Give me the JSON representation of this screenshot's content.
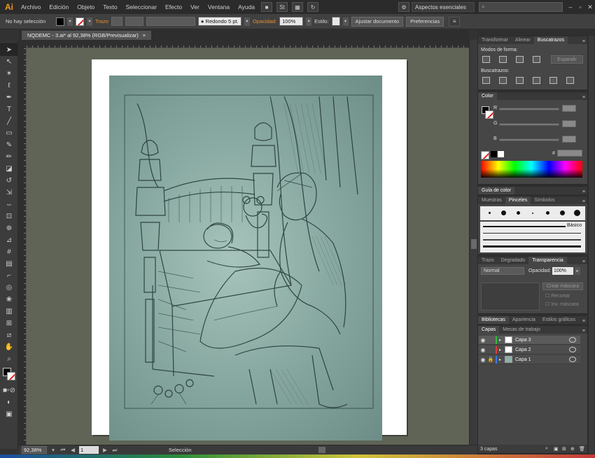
{
  "app": {
    "logo": "Ai"
  },
  "menu": [
    "Archivo",
    "Edición",
    "Objeto",
    "Texto",
    "Seleccionar",
    "Efecto",
    "Ver",
    "Ventana",
    "Ayuda"
  ],
  "menubar_right": {
    "workspace": "Aspectos esenciales",
    "search_placeholder": ""
  },
  "control": {
    "selection": "No hay selección",
    "stroke_label": "Trazo",
    "brush": "Redondo 5 pt.",
    "opacity_label": "Opacidad:",
    "opacity": "100%",
    "style_label": "Estilo:",
    "doc_setup": "Ajustar documento",
    "prefs": "Preferencias"
  },
  "document": {
    "tab_title": "NQDEMC - 3.ai* al 92,38% (RGB/Previsualizar)",
    "close": "×"
  },
  "status": {
    "zoom": "92,38%",
    "page": "1",
    "tool": "Selección"
  },
  "pathfinder": {
    "tabs": [
      "Transformar",
      "Alinear",
      "Buscatrazos"
    ],
    "shape_modes_label": "Modos de forma:",
    "expand_button": "Expandir",
    "pathfinders_label": "Buscatrazos:"
  },
  "color_panel": {
    "title": "Color",
    "channels": [
      "R",
      "G",
      "B"
    ],
    "hex_sign": "#"
  },
  "color_guide": {
    "title": "Guía de color"
  },
  "brushes": {
    "tabs": [
      "Muestras",
      "Pinceles",
      "Símbolos"
    ],
    "basic_label": "Básico"
  },
  "transparency": {
    "tabs": [
      "Trazo",
      "Degradado",
      "Transparencia"
    ],
    "blend_mode": "Normal",
    "opacity_label": "Opacidad:",
    "opacity": "100%",
    "make_mask": "Crear máscara",
    "clip": "Recortar",
    "invert": "Inv. máscara"
  },
  "libraries": {
    "tabs": [
      "Bibliotecas",
      "Apariencia",
      "Estilos gráficos"
    ]
  },
  "layers": {
    "tabs": [
      "Capas",
      "Mesas de trabajo"
    ],
    "rows": [
      {
        "name": "Capa 3",
        "color": "#2fbf3a"
      },
      {
        "name": "Capa 2",
        "color": "#e23b3b"
      },
      {
        "name": "Capa 1",
        "color": "#3a7be0"
      }
    ],
    "count": "3 capas"
  },
  "colors": {
    "accent_orange": "#e8902a",
    "canvas": "#5f6456",
    "panel": "#464646"
  },
  "icons": [
    "selection-tool-icon",
    "direct-selection-icon",
    "magic-wand-icon",
    "lasso-icon",
    "pen-icon",
    "type-icon",
    "line-icon",
    "rectangle-icon",
    "paintbrush-icon",
    "pencil-icon",
    "eraser-icon",
    "rotate-icon",
    "scale-icon",
    "width-icon",
    "free-transform-icon",
    "shape-builder-icon",
    "perspective-icon",
    "mesh-icon",
    "gradient-icon",
    "eyedropper-icon",
    "blend-icon",
    "symbol-sprayer-icon",
    "column-graph-icon",
    "artboard-icon",
    "slice-icon",
    "hand-icon",
    "zoom-icon"
  ]
}
